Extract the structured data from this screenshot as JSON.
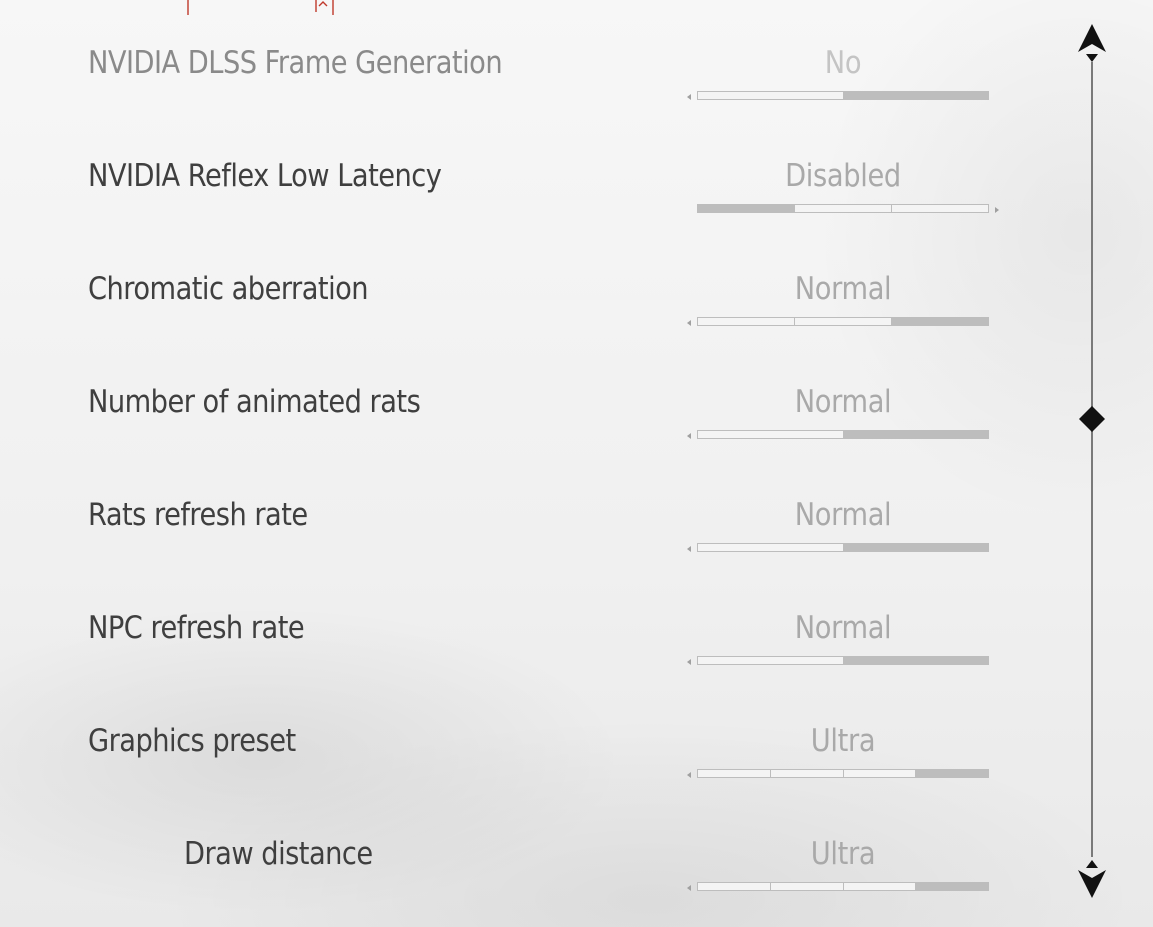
{
  "settings": [
    {
      "label": "NVIDIA DLSS Frame Generation",
      "value": "No",
      "segments": 2,
      "selected": 2,
      "arrow": "left",
      "enabled": false
    },
    {
      "label": "NVIDIA Reflex Low Latency",
      "value": "Disabled",
      "segments": 3,
      "selected": 1,
      "arrow": "right",
      "enabled": true
    },
    {
      "label": "Chromatic aberration",
      "value": "Normal",
      "segments": 3,
      "selected": 3,
      "arrow": "left",
      "enabled": true
    },
    {
      "label": "Number of animated rats",
      "value": "Normal",
      "segments": 2,
      "selected": 2,
      "arrow": "left",
      "enabled": true
    },
    {
      "label": "Rats refresh rate",
      "value": "Normal",
      "segments": 2,
      "selected": 2,
      "arrow": "left",
      "enabled": true
    },
    {
      "label": "NPC refresh rate",
      "value": "Normal",
      "segments": 2,
      "selected": 2,
      "arrow": "left",
      "enabled": true
    },
    {
      "label": "Graphics preset",
      "value": "Ultra",
      "segments": 4,
      "selected": 4,
      "arrow": "left",
      "enabled": true
    },
    {
      "label": "Draw distance",
      "value": "Ultra",
      "segments": 4,
      "selected": 4,
      "arrow": "left",
      "enabled": true,
      "indented": true
    }
  ],
  "icons": {
    "scroll_up": "scroll-up-arrow-icon",
    "scroll_down": "scroll-down-arrow-icon",
    "scroll_thumb": "diamond-thumb-icon"
  },
  "colors": {
    "label": "#3f3f3f",
    "label_disabled": "#8a8a8a",
    "value": "#a9a9a9",
    "segment_on": "#bdbdbd",
    "accent_red": "#c0392b"
  }
}
